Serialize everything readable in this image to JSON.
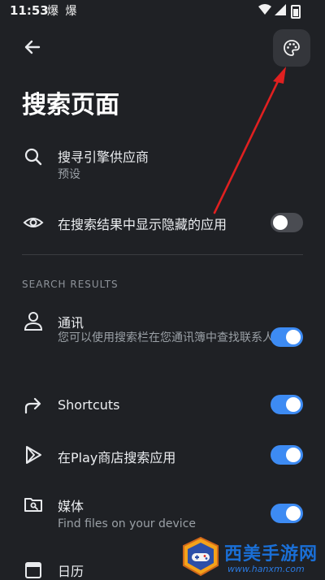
{
  "status_bar": {
    "time": "11:53",
    "notification_icons": "爆 爆"
  },
  "toolbar": {
    "back_icon": "arrow-left-icon",
    "palette_icon": "palette-icon"
  },
  "page": {
    "title": "搜索页面"
  },
  "search_provider": {
    "title": "搜寻引擎供应商",
    "subtitle": "预设",
    "icon": "search-icon"
  },
  "show_hidden": {
    "title": "在搜索结果中显示隐藏的应用",
    "icon": "eye-icon",
    "enabled": false
  },
  "section": {
    "header": "SEARCH RESULTS"
  },
  "results": [
    {
      "title": "通讯",
      "subtitle": "您可以使用搜索栏在您通讯簿中查找联系人",
      "icon": "person-icon",
      "enabled": true
    },
    {
      "title": "Shortcuts",
      "icon": "share-arrow-icon",
      "enabled": true
    },
    {
      "title": "在Play商店搜索应用",
      "icon": "play-icon",
      "enabled": true
    },
    {
      "title": "媒体",
      "subtitle": "Find files on your device",
      "icon": "folder-search-icon",
      "enabled": true
    },
    {
      "title": "日历",
      "icon": "calendar-icon"
    }
  ],
  "watermark": {
    "name": "西美手游网",
    "url": "www.hanxm.com"
  },
  "colors": {
    "background": "#1f2125",
    "accent": "#3d8bf3",
    "arrow": "#e02020"
  }
}
